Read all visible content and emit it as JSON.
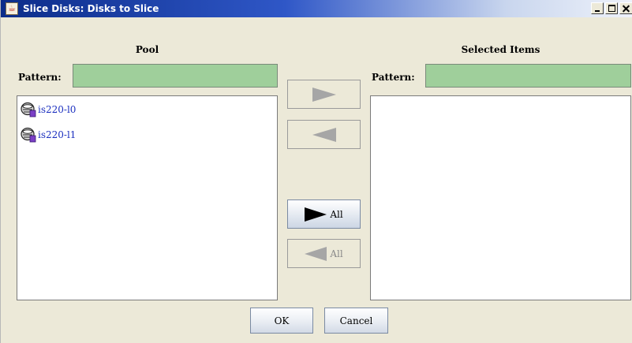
{
  "window": {
    "title": "Slice Disks: Disks to Slice",
    "title_icon": "java-cup-icon"
  },
  "pool": {
    "heading": "Pool",
    "pattern_label": "Pattern:",
    "pattern_value": "",
    "items": [
      {
        "label": "is220-l0",
        "icon": "disk-icon"
      },
      {
        "label": "is220-l1",
        "icon": "disk-icon"
      }
    ]
  },
  "selected": {
    "heading": "Selected Items",
    "pattern_label": "Pattern:",
    "pattern_value": "",
    "items": []
  },
  "transfer": {
    "all_right_label": "All",
    "all_left_label": "All"
  },
  "buttons": {
    "ok_label": "OK",
    "cancel_label": "Cancel"
  },
  "colors": {
    "pattern_field_bg": "#9fcf9b",
    "item_text": "#1b2fbf",
    "title_bar_start": "#0c2d8a"
  }
}
